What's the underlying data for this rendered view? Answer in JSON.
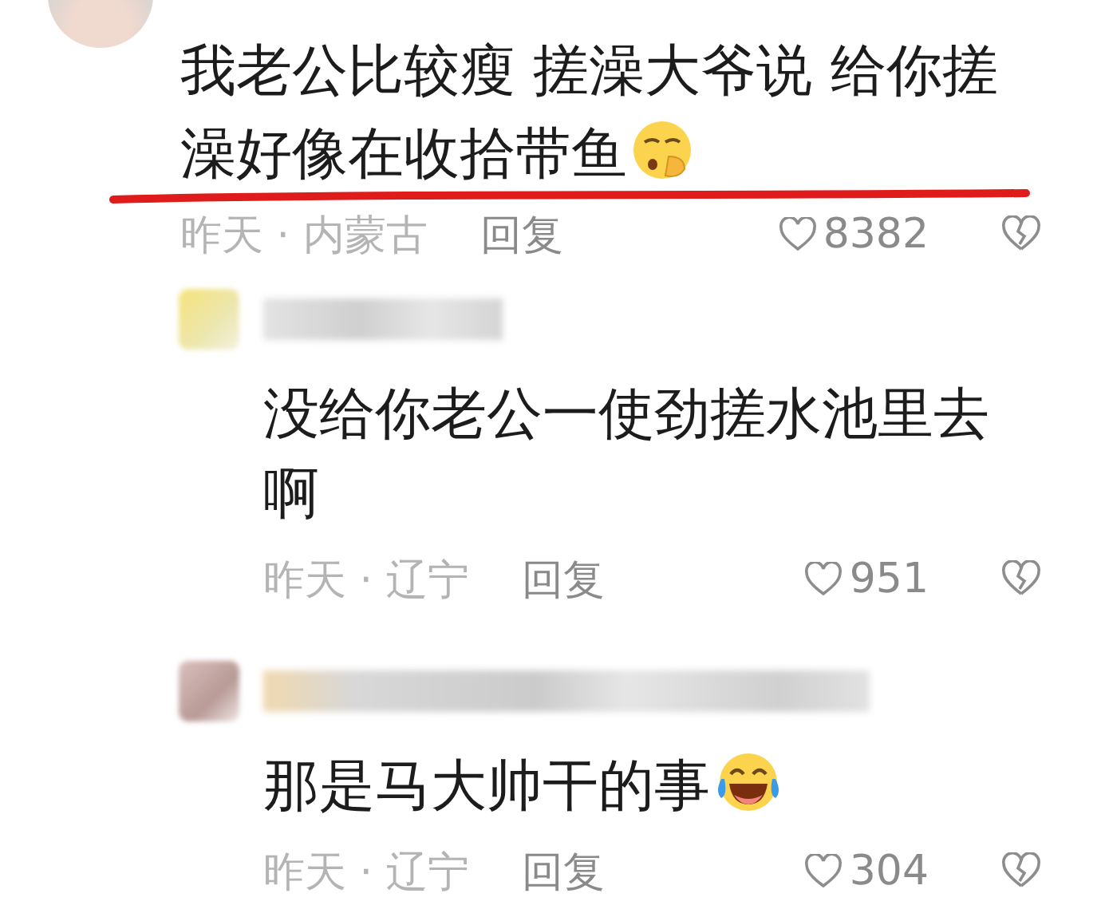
{
  "comment": {
    "text": "我老公比较瘦 搓澡大爷说 给你搓澡好像在收拾带鱼",
    "emoji": {
      "kind": "sulky"
    },
    "underlined": true,
    "meta": "昨天 · 内蒙古",
    "reply_label": "回复",
    "likes": "8382"
  },
  "replies": [
    {
      "text": "没给你老公一使劲搓水池里去啊",
      "underlined": false,
      "meta": "昨天 · 辽宁",
      "reply_label": "回复",
      "likes": "951"
    },
    {
      "text": "那是马大帅干的事",
      "emoji": {
        "kind": "tears-of-joy"
      },
      "underlined": false,
      "meta": "昨天 · 辽宁",
      "reply_label": "回复",
      "likes": "304"
    }
  ]
}
